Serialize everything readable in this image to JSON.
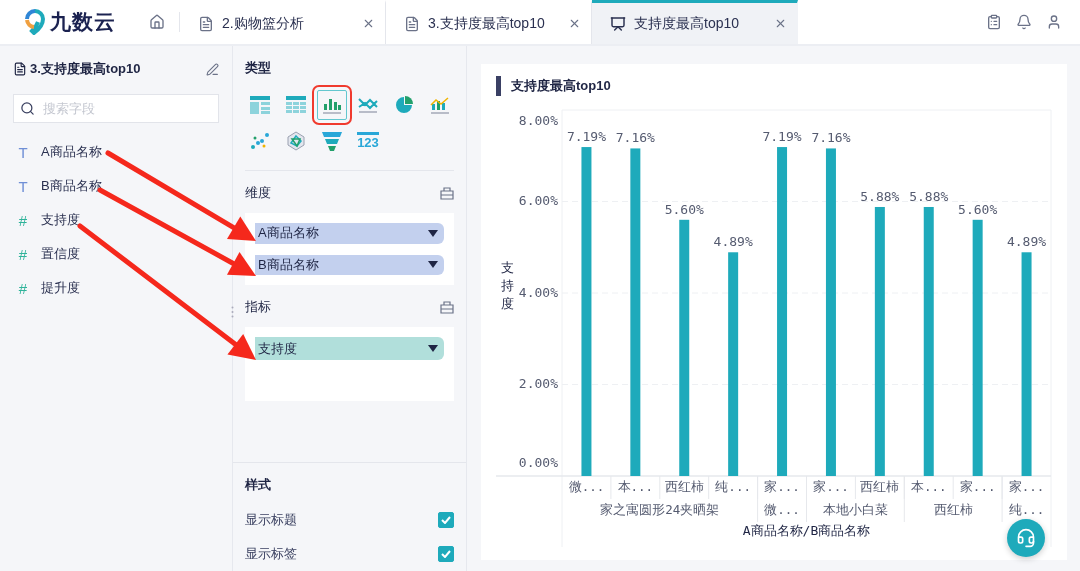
{
  "logo": {
    "name": "九数云"
  },
  "tabs": [
    {
      "kind": "home",
      "selected": false
    },
    {
      "kind": "doc",
      "label": "2.购物篮分析",
      "selected": false
    },
    {
      "kind": "doc",
      "label": "3.支持度最高top10",
      "selected": false
    },
    {
      "kind": "screen",
      "label": "支持度最高top10",
      "selected": true
    }
  ],
  "fields_panel": {
    "title": "3.支持度最高top10",
    "search": {
      "placeholder": "搜索字段"
    },
    "fields": [
      {
        "kind": "text",
        "mark": "T",
        "name": "A商品名称"
      },
      {
        "kind": "text",
        "mark": "T",
        "name": "B商品名称"
      },
      {
        "kind": "number",
        "mark": "#",
        "name": "支持度"
      },
      {
        "kind": "number",
        "mark": "#",
        "name": "置信度"
      },
      {
        "kind": "number",
        "mark": "#",
        "name": "提升度"
      }
    ]
  },
  "config_panel": {
    "type_title": "类型",
    "chart_types": [
      {
        "kind": "table",
        "selected": false
      },
      {
        "kind": "crosstab",
        "selected": false
      },
      {
        "kind": "bar",
        "selected": true
      },
      {
        "kind": "line",
        "selected": false
      },
      {
        "kind": "pie",
        "selected": false
      },
      {
        "kind": "combo",
        "selected": false
      },
      {
        "kind": "scatter",
        "selected": false
      },
      {
        "kind": "radar",
        "selected": false
      },
      {
        "kind": "funnel",
        "selected": false
      },
      {
        "kind": "number",
        "label": "123",
        "selected": false
      }
    ],
    "dimensions": {
      "title": "维度",
      "items": [
        {
          "kind": "dimension",
          "label": "A商品名称"
        },
        {
          "kind": "dimension",
          "label": "B商品名称"
        }
      ]
    },
    "measures": {
      "title": "指标",
      "items": [
        {
          "kind": "measure",
          "label": "支持度"
        }
      ]
    },
    "style": {
      "title": "样式",
      "options": [
        {
          "label": "显示标题",
          "checked": true
        },
        {
          "label": "显示标签",
          "checked": true
        }
      ]
    }
  },
  "chart": {
    "title": "支持度最高top10",
    "category_groups": [
      {
        "label": "家之寓圆形24夹晒架",
        "categories": [
          "微...",
          "本...",
          "西红柿",
          "纯..."
        ]
      },
      {
        "label": "微...",
        "categories": [
          "家..."
        ]
      },
      {
        "label": "本地小白菜",
        "categories": [
          "家...",
          "西红柿"
        ]
      },
      {
        "label": "西红柿",
        "categories": [
          "本...",
          "家..."
        ]
      },
      {
        "label": "纯...",
        "categories": [
          "家..."
        ]
      }
    ],
    "chart_data": {
      "type": "bar",
      "grid": true,
      "xlabel": "A商品名称/B商品名称",
      "ylabel": "支持度",
      "ylim": [
        0,
        8
      ],
      "yticks": [
        {
          "value": 0,
          "label": "0.00%"
        },
        {
          "value": 2,
          "label": "2.00%"
        },
        {
          "value": 4,
          "label": "4.00%"
        },
        {
          "value": 6,
          "label": "6.00%"
        },
        {
          "value": 8,
          "label": "8.00%"
        }
      ],
      "series": [
        {
          "color": "#1eaabb",
          "values": [
            7.19,
            7.16,
            5.6,
            4.89,
            7.19,
            7.16,
            5.88,
            5.88,
            5.6,
            4.89
          ]
        }
      ],
      "value_labels": [
        "7.19%",
        "7.16%",
        "5.60%",
        "4.89%",
        "7.19%",
        "7.16%",
        "5.88%",
        "5.88%",
        "5.60%",
        "4.89%"
      ]
    }
  }
}
